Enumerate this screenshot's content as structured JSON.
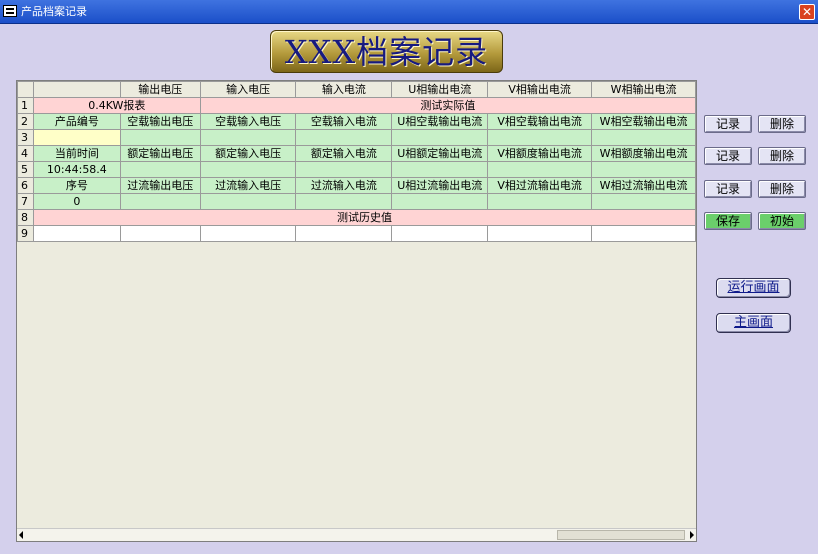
{
  "window": {
    "title": "产品档案记录",
    "close_glyph": "✕"
  },
  "banner": {
    "text": "XXX档案记录"
  },
  "grid": {
    "columns": [
      "",
      "",
      "输出电压",
      "输入电压",
      "输入电流",
      "U相输出电流",
      "V相输出电流",
      "W相输出电流"
    ],
    "row1": {
      "num": "1",
      "left": "0.4KW报表",
      "right": "测试实际值"
    },
    "row2": {
      "num": "2",
      "cells": [
        "产品编号",
        "空载输出电压",
        "空载输入电压",
        "空载输入电流",
        "U相空载输出电流",
        "V相空载输出电流",
        "W相空载输出电流"
      ]
    },
    "row3": {
      "num": "3"
    },
    "row4": {
      "num": "4",
      "cells": [
        "当前时间",
        "额定输出电压",
        "额定输入电压",
        "额定输入电流",
        "U相额定输出电流",
        "V相额度输出电流",
        "W相额度输出电流"
      ]
    },
    "row5": {
      "num": "5",
      "cells": [
        "10:44:58.4"
      ]
    },
    "row6": {
      "num": "6",
      "cells": [
        "序号",
        "过流输出电压",
        "过流输入电压",
        "过流输入电流",
        "U相过流输出电流",
        "V相过流输出电流",
        "W相过流输出电流"
      ]
    },
    "row7": {
      "num": "7",
      "cells": [
        "0"
      ]
    },
    "row8": {
      "num": "8",
      "text": "测试历史值"
    },
    "row9": {
      "num": "9"
    }
  },
  "buttons": {
    "record": "记录",
    "delete": "删除",
    "save": "保存",
    "init": "初始",
    "run_screen": "运行画面",
    "main_screen": "主画面"
  },
  "colors": {
    "title_bar": "#2a5bd7",
    "pink_row": "#ffd4d4",
    "green_row": "#c8f0c8",
    "yellow_cell": "#ffffc8",
    "background": "#d4d0ec"
  }
}
